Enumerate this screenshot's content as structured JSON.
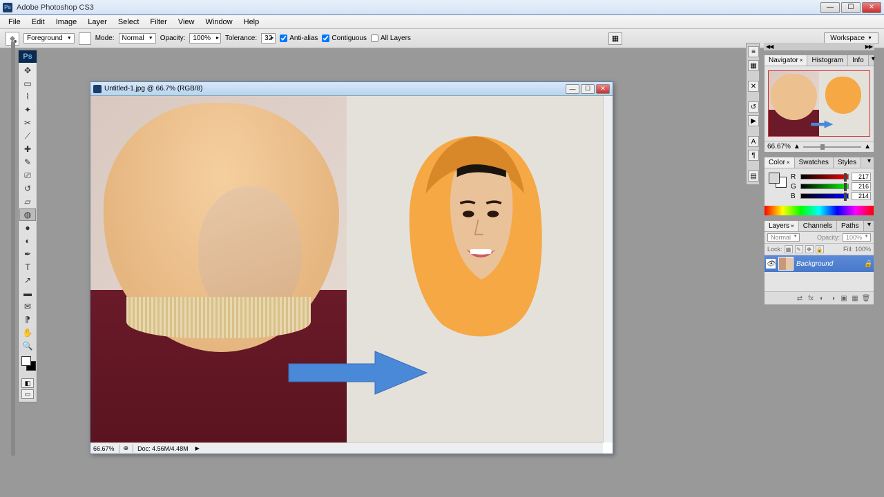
{
  "app": {
    "title": "Adobe Photoshop CS3"
  },
  "menus": [
    "File",
    "Edit",
    "Image",
    "Layer",
    "Select",
    "Filter",
    "View",
    "Window",
    "Help"
  ],
  "options": {
    "fill_label": "Foreground",
    "mode_label": "Mode:",
    "mode_value": "Normal",
    "opacity_label": "Opacity:",
    "opacity_value": "100%",
    "tolerance_label": "Tolerance:",
    "tolerance_value": "32",
    "antialias": "Anti-alias",
    "contiguous": "Contiguous",
    "all_layers": "All Layers",
    "workspace": "Workspace"
  },
  "document": {
    "title": "Untitled-1.jpg @ 66.7% (RGB/8)",
    "zoom": "66.67%",
    "doc_size": "Doc: 4.56M/4.48M"
  },
  "panels": {
    "navigator": {
      "tabs": [
        "Navigator",
        "Histogram",
        "Info"
      ],
      "zoom": "66.67%"
    },
    "color": {
      "tabs": [
        "Color",
        "Swatches",
        "Styles"
      ],
      "r_label": "R",
      "r_value": "217",
      "g_label": "G",
      "g_value": "216",
      "b_label": "B",
      "b_value": "214"
    },
    "layers": {
      "tabs": [
        "Layers",
        "Channels",
        "Paths"
      ],
      "blend": "Normal",
      "opacity_label": "Opacity:",
      "opacity_value": "100%",
      "lock_label": "Lock:",
      "fill_label": "Fill:",
      "fill_value": "100%",
      "layer_name": "Background"
    }
  }
}
